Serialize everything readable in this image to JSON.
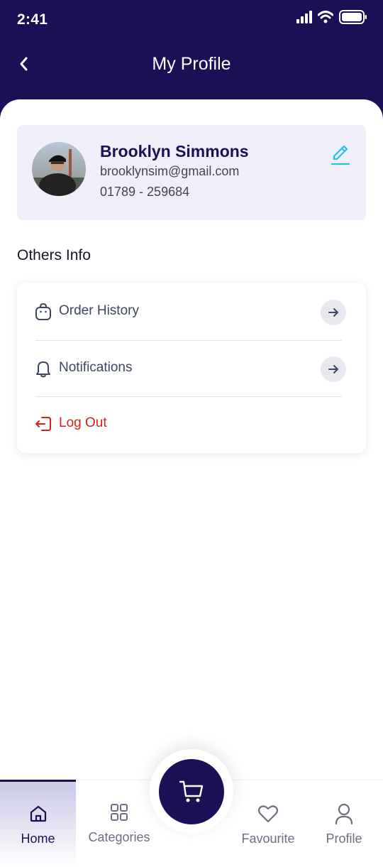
{
  "status_bar": {
    "time": "2:41"
  },
  "header": {
    "title": "My Profile"
  },
  "profile": {
    "name": "Brooklyn Simmons",
    "email": "brooklynsim@gmail.com",
    "phone": "01789 - 259684"
  },
  "others_info": {
    "title": "Others Info",
    "items": [
      {
        "label": "Order History",
        "icon": "shopping-bag-icon"
      },
      {
        "label": "Notifications",
        "icon": "bell-icon"
      },
      {
        "label": "Log Out",
        "icon": "logout-icon"
      }
    ]
  },
  "bottom_nav": {
    "items": [
      {
        "label": "Home",
        "icon": "home-icon",
        "active": true
      },
      {
        "label": "Categories",
        "icon": "grid-icon"
      },
      {
        "label": "Favourite",
        "icon": "heart-icon"
      },
      {
        "label": "Profile",
        "icon": "user-icon"
      }
    ],
    "cart_icon": "cart-icon"
  },
  "colors": {
    "primary": "#1a1056",
    "accent_edit": "#22c3dd",
    "danger": "#d32020",
    "card_bg": "#f0eff9"
  }
}
